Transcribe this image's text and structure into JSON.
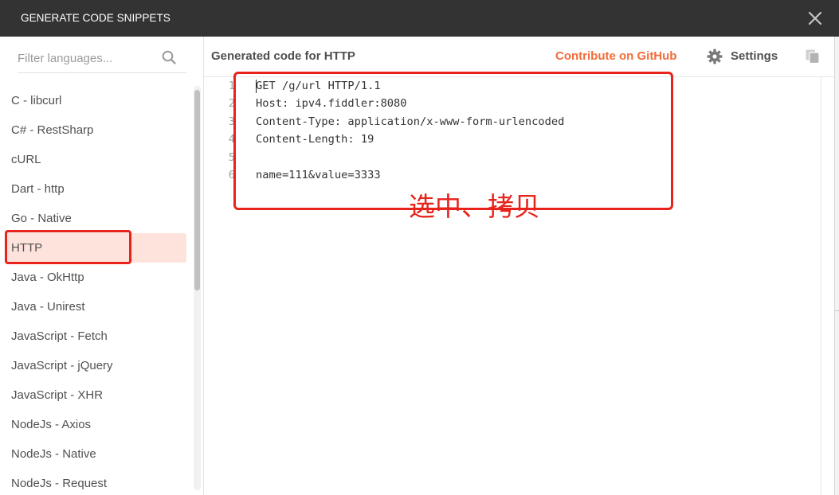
{
  "modal": {
    "title": "GENERATE CODE SNIPPETS",
    "close_icon": "close-icon"
  },
  "sidebar": {
    "search": {
      "placeholder": "Filter languages...",
      "icon": "search-icon"
    },
    "items": [
      {
        "label": "C - libcurl"
      },
      {
        "label": "C# - RestSharp"
      },
      {
        "label": "cURL"
      },
      {
        "label": "Dart - http"
      },
      {
        "label": "Go - Native"
      },
      {
        "label": "HTTP",
        "selected": true
      },
      {
        "label": "Java - OkHttp"
      },
      {
        "label": "Java - Unirest"
      },
      {
        "label": "JavaScript - Fetch"
      },
      {
        "label": "JavaScript - jQuery"
      },
      {
        "label": "JavaScript - XHR"
      },
      {
        "label": "NodeJs - Axios"
      },
      {
        "label": "NodeJs - Native"
      },
      {
        "label": "NodeJs - Request"
      }
    ]
  },
  "main": {
    "heading": "Generated code for HTTP",
    "contribute_link": "Contribute on GitHub",
    "settings": {
      "label": "Settings",
      "icon": "gear-icon"
    },
    "copy_icon": "copy-icon",
    "code": {
      "lines": [
        {
          "number": 1,
          "text": "GET /g/url HTTP/1.1"
        },
        {
          "number": 2,
          "text": "Host: ipv4.fiddler:8080"
        },
        {
          "number": 3,
          "text": "Content-Type: application/x-www-form-urlencoded"
        },
        {
          "number": 4,
          "text": "Content-Length: 19"
        },
        {
          "number": 5,
          "text": ""
        },
        {
          "number": 6,
          "text": "name=111&value=3333"
        }
      ]
    }
  },
  "annotation": {
    "text": "选中、拷贝"
  },
  "colors": {
    "header_background": "#333333",
    "accent": "#f26b3a",
    "selected_background": "#fde3db",
    "annotation": "#e8231c",
    "text": "#505050"
  }
}
